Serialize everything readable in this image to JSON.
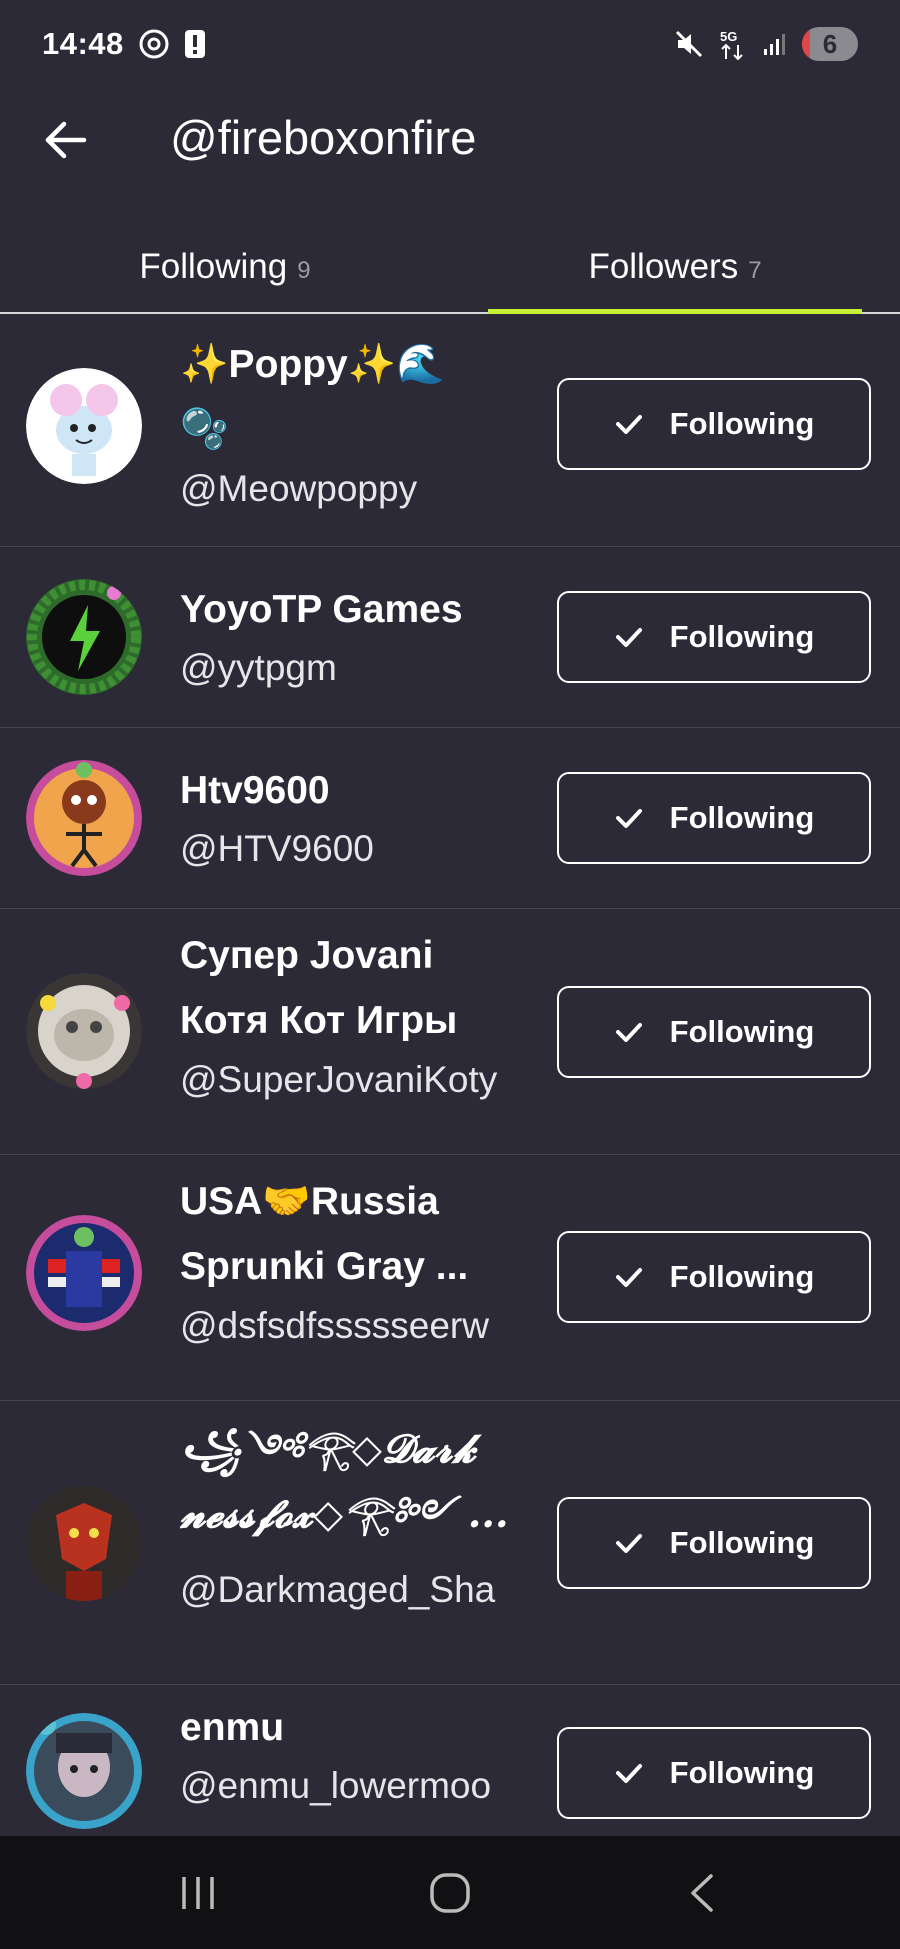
{
  "status_bar": {
    "time": "14:48",
    "battery": "6",
    "network": "5G",
    "icons": [
      "at-sign-icon",
      "alert-icon",
      "mute-icon",
      "network-5g-icon",
      "signal-icon",
      "battery-icon"
    ]
  },
  "header": {
    "back_icon": "arrow-left-icon",
    "title": "@fireboxonfire"
  },
  "tabs": [
    {
      "label": "Following",
      "count": "9",
      "active": false
    },
    {
      "label": "Followers",
      "count": "7",
      "active": true
    }
  ],
  "accent_color": "#c6f135",
  "button_label": "Following",
  "users": [
    {
      "name_line1": "✨Poppy✨🌊",
      "name_line2": "🫧",
      "handle": "@Meowpoppy"
    },
    {
      "name_line1": "YoyoTP Games",
      "name_line2": "",
      "handle": "@yytpgm"
    },
    {
      "name_line1": "Htv9600",
      "name_line2": "",
      "handle": "@HTV9600"
    },
    {
      "name_line1": "Супер Jovani",
      "name_line2": "Котя Кот Игры",
      "handle": "@SuperJovaniKoty"
    },
    {
      "name_line1": "USA🤝Russia",
      "name_line2": "Sprunki Gray ...",
      "handle": "@dsfsdfssssseerw"
    },
    {
      "name_line1": "꧁༺𓂀◇𝓓𝓪𝓻𝓴",
      "name_line2": "𝓷𝓮𝓼𝓼𝓯𝓸𝔁◇𓂀༻ ...",
      "handle": "@Darkmaged_Sha"
    },
    {
      "name_line1": "enmu",
      "name_line2": "",
      "handle": "@enmu_lowermoo"
    }
  ],
  "nav_bar": {
    "icons": [
      "recent-apps-icon",
      "home-icon",
      "back-nav-icon"
    ]
  }
}
